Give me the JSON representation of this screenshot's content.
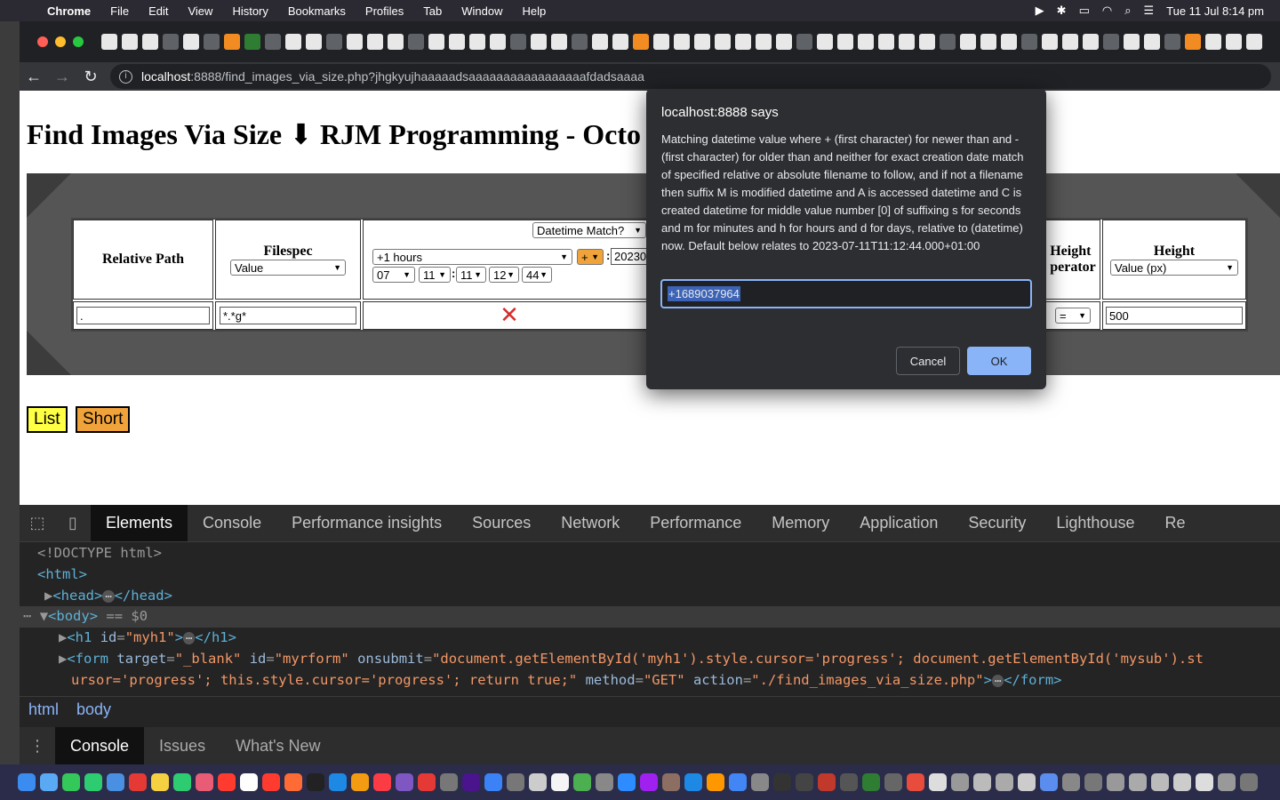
{
  "menubar": {
    "app": "Chrome",
    "items": [
      "File",
      "Edit",
      "View",
      "History",
      "Bookmarks",
      "Profiles",
      "Tab",
      "Window",
      "Help"
    ],
    "clock": "Tue 11 Jul  8:14 pm"
  },
  "browser": {
    "url_host": "localhost",
    "url_rest": ":8888/find_images_via_size.php?jhgkyujhaaaaadsaaaaaaaaaaaaaaaaafdadsaaaa"
  },
  "page": {
    "title": "Find Images Via Size ⬇ RJM Programming - Octo",
    "relative_path_label": "Relative Path",
    "filespec_label": "Filespec",
    "filespec_select": "Value",
    "datetime_select": "Datetime Match?",
    "hours_select": "+1 hours",
    "plus_select": "+",
    "year_value": "20230",
    "time_selects": [
      "07",
      "11",
      "11",
      "12",
      "44"
    ],
    "height_operator_label": "Height Operator",
    "height_operator_label_visible": "Height\nperator",
    "height_label": "Height",
    "height_select": "Value (px)",
    "relative_path_value": ".",
    "filespec_value": "*.*g*",
    "operator_value": "=",
    "height_value": "500",
    "list_button": "List",
    "short_button": "Short"
  },
  "dialog": {
    "title": "localhost:8888 says",
    "message": "Matching datetime value where + (first character) for newer than and - (first character) for older than and neither for exact creation date match of specified relative or absolute filename to follow, and if not a filename then suffix M is modified datetime and A is accessed datetime and C is created datetime for middle value number [0] of suffixing s for seconds and m for minutes and h for hours and d for days, relative to (datetime) now. Default below relates to 2023-07-11T11:12:44.000+01:00",
    "input_value": "+1689037964",
    "cancel_label": "Cancel",
    "ok_label": "OK"
  },
  "devtools": {
    "tabs": [
      "Elements",
      "Console",
      "Performance insights",
      "Sources",
      "Network",
      "Performance",
      "Memory",
      "Application",
      "Security",
      "Lighthouse",
      "Re"
    ],
    "active_tab": "Elements",
    "code": {
      "doctype": "<!DOCTYPE html>",
      "html_open": "<html>",
      "head_open": "<head>",
      "head_close": "</head>",
      "body_open": "<body>",
      "body_eq": "== $0",
      "h1_open": "<h1",
      "h1_attr": "id",
      "h1_val": "\"myh1\"",
      "h1_close": "</h1>",
      "form_line1_a": "<form",
      "form_attr1": "target",
      "form_val1": "\"_blank\"",
      "form_attr2": "id",
      "form_val2": "\"myrform\"",
      "form_attr3": "onsubmit",
      "form_val3": "\"document.getElementById('myh1').style.cursor='progress'; document.getElementById('mysub').st",
      "form_line2_val": "ursor='progress'; this.style.cursor='progress'; return true;\"",
      "form_attr4": "method",
      "form_val4": "\"GET\"",
      "form_attr5": "action",
      "form_val5": "\"./find_images_via_size.php\"",
      "form_close": "</form>"
    },
    "crumbs": [
      "html",
      "body"
    ],
    "drawer_tabs": [
      "Console",
      "Issues",
      "What's New"
    ],
    "drawer_active": "Console"
  },
  "colors": {
    "accent": "#8ab4f8",
    "list_button": "#ffff44",
    "short_button": "#f0a33a",
    "cross": "#d32f2f"
  }
}
